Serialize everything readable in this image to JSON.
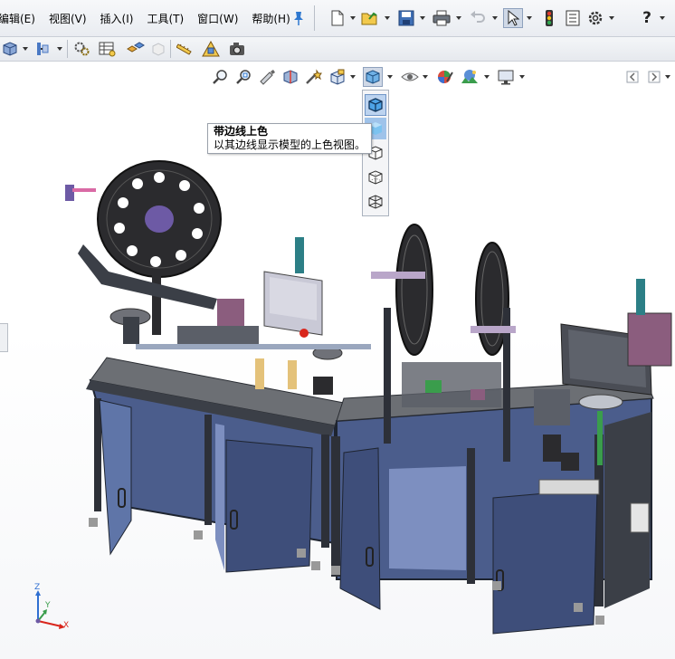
{
  "menu": {
    "items": [
      "编辑(E)",
      "视图(V)",
      "插入(I)",
      "工具(T)",
      "窗口(W)",
      "帮助(H)"
    ]
  },
  "toolbar": {
    "main_icons": [
      "new-document-icon",
      "open-folder-icon",
      "save-icon",
      "print-icon",
      "undo-icon",
      "select-pointer-icon",
      "rebuild-traffic-light-icon",
      "file-properties-icon",
      "options-gear-icon",
      "help-icon"
    ],
    "help_glyph": "?"
  },
  "display_style_tooltip": {
    "title": "带边线上色",
    "description": "以其边线显示模型的上色视图。"
  },
  "display_style_menu": {
    "options": [
      "shaded-with-edges",
      "shaded",
      "hidden-lines-removed",
      "hidden-lines-visible",
      "wireframe"
    ],
    "selected": "shaded-with-edges"
  },
  "triad": {
    "x": "X",
    "y": "Y",
    "z": "Z"
  },
  "colors": {
    "frame": "#3b3f47",
    "panel": "#4b5d8c",
    "panel_light": "#7d8fc0",
    "table_top": "#6c6f74",
    "accent_blue": "#2f6fd1",
    "selection": "#bcd3ef"
  }
}
